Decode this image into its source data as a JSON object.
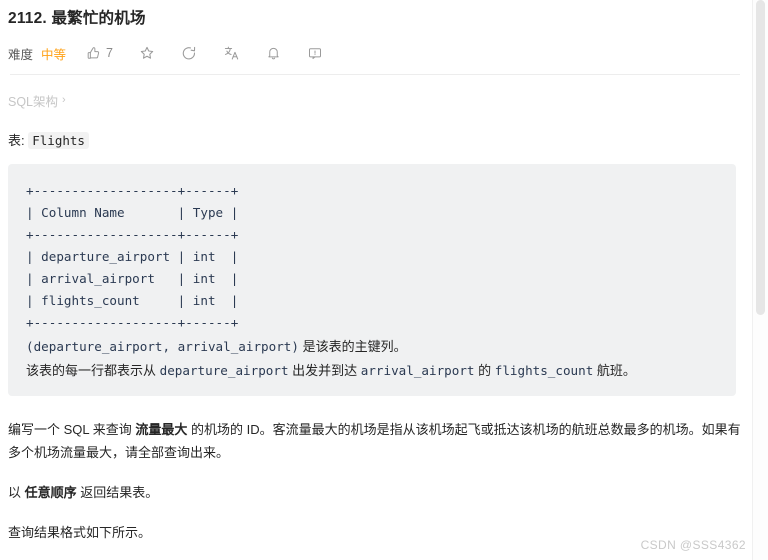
{
  "problem": {
    "title": "2112. 最繁忙的机场",
    "difficulty_label": "难度",
    "difficulty_value": "中等",
    "difficulty_color": "#ffa116",
    "likes_count": "7"
  },
  "actions": [
    {
      "name": "like-icon",
      "icon": "thumbs-up-icon",
      "count": "7"
    },
    {
      "name": "favorite-icon",
      "icon": "star-icon",
      "count": ""
    },
    {
      "name": "share-icon",
      "icon": "circle-arrow-icon",
      "count": ""
    },
    {
      "name": "translate-icon",
      "icon": "translate-icon",
      "count": ""
    },
    {
      "name": "notify-icon",
      "icon": "bell-icon",
      "count": ""
    },
    {
      "name": "feedback-icon",
      "icon": "comment-icon",
      "count": ""
    }
  ],
  "schema": {
    "toggle_label": "SQL架构",
    "toggle_chevron": "›",
    "table_prefix": "表:",
    "table_name": "Flights",
    "ascii_table": "+-------------------+------+\n| Column Name       | Type |\n+-------------------+------+\n| departure_airport | int  |\n| arrival_airport   | int  |\n| flights_count     | int  |\n+-------------------+------+",
    "note_line_1_code": "(departure_airport, arrival_airport)",
    "note_line_1_text": " 是该表的主键列。",
    "note_line_2_a": "该表的每一行都表示从 ",
    "note_line_2_code_1": "departure_airport",
    "note_line_2_b": " 出发并到达 ",
    "note_line_2_code_2": "arrival_airport",
    "note_line_2_c": " 的 ",
    "note_line_2_code_3": "flights_count",
    "note_line_2_d": " 航班。"
  },
  "description": {
    "p1_a": "编写一个 SQL 来查询 ",
    "p1_bold": "流量最大",
    "p1_b": " 的机场的 ID。客流量最大的机场是指从该机场起飞或抵达该机场的航班总数最多的机场。如果有多个机场流量最大，请全部查询出来。",
    "p2_a": "以 ",
    "p2_bold": "任意顺序",
    "p2_b": " 返回结果表。",
    "p3": "查询结果格式如下所示。"
  },
  "watermark": "CSDN @SSS4362"
}
